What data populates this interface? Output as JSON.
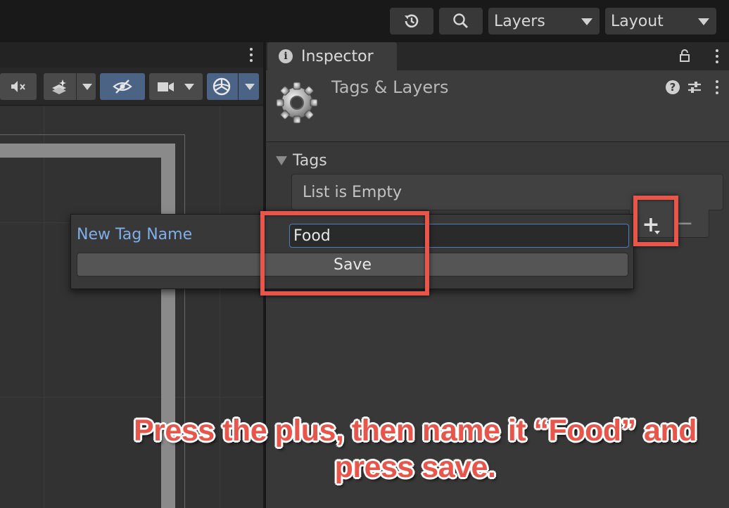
{
  "toolbar": {
    "history_icon": "history-icon",
    "search_icon": "search-icon",
    "layers_dropdown": "Layers",
    "layout_dropdown": "Layout"
  },
  "scene_view": {
    "toolbar_icons": [
      "audio-mute-icon",
      "effects-icon",
      "hidden-objects-icon",
      "camera-icon",
      "gizmos-icon"
    ]
  },
  "inspector": {
    "tab_label": "Inspector",
    "title": "Tags & Layers",
    "tags_section": {
      "label": "Tags",
      "empty_text": "List is Empty"
    }
  },
  "popup": {
    "field_label": "New Tag Name",
    "input_value": "Food",
    "save_label": "Save"
  },
  "annotation": {
    "caption": "Press the plus, then name it “Food” and press save.",
    "highlight_color": "#e8564b"
  },
  "colors": {
    "accent_blue": "#4b6485",
    "focus_border": "#4d7fbd",
    "label_blue": "#7faee8"
  }
}
